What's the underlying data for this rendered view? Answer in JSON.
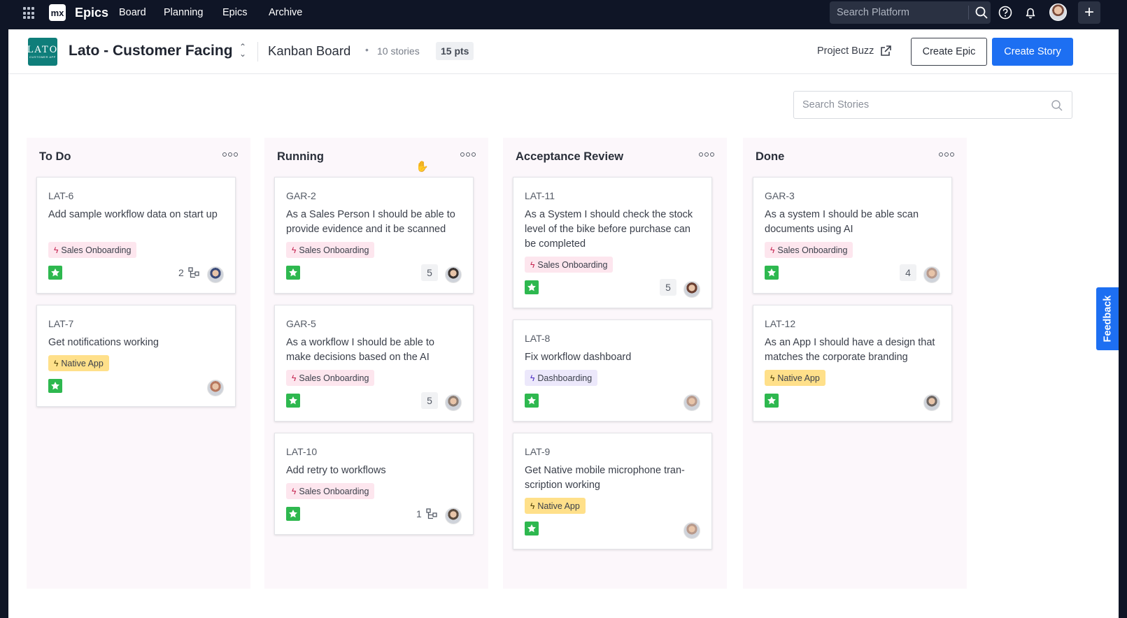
{
  "topnav": {
    "logo": "mx",
    "app_name": "Epics",
    "links": [
      "Board",
      "Planning",
      "Epics",
      "Archive"
    ],
    "search_placeholder": "Search Platform"
  },
  "header": {
    "logo_text": "LATO",
    "logo_subtext": "CUSTOMER APP",
    "project_title": "Lato - Customer Facing",
    "board_title": "Kanban Board",
    "dot": "•",
    "stories_count": "10 stories",
    "points": "15 pts",
    "project_buzz": "Project Buzz",
    "create_epic": "Create Epic",
    "create_story": "Create Story"
  },
  "search_stories_placeholder": "Search Stories",
  "feedback": "Feedback",
  "columns": [
    {
      "title": "To Do",
      "cards": [
        {
          "id": "LAT-6",
          "title": "Add sample workflow data on start up",
          "tag": "Sales Onboarding",
          "subtasks": "2",
          "avatar_color": "#3b4a78"
        },
        {
          "id": "LAT-7",
          "title": "Get notifications working",
          "tag": "Native App",
          "avatar_color": "#b7785f"
        }
      ]
    },
    {
      "title": "Running",
      "cards": [
        {
          "id": "GAR-2",
          "title": "As a Sales Person I should be able to provide evidence and it be scanned",
          "tag": "Sales Onboarding",
          "points": "5",
          "avatar_color": "#3a3330"
        },
        {
          "id": "GAR-5",
          "title": "As a workflow I should be able to make decisions based on the AI",
          "tag": "Sales Onboarding",
          "points": "5",
          "avatar_color": "#8c7c72"
        },
        {
          "id": "LAT-10",
          "title": "Add retry to workflows",
          "tag": "Sales Onboarding",
          "subtasks": "1",
          "avatar_color": "#5a4a3e"
        }
      ]
    },
    {
      "title": "Acceptance Review",
      "cards": [
        {
          "id": "LAT-11",
          "title": "As a System I should check the stock level of the bike before purchase can be completed",
          "tag": "Sales Onboarding",
          "points": "5",
          "avatar_color": "#6b4032"
        },
        {
          "id": "LAT-8",
          "title": "Fix workflow dashboard",
          "tag": "Dashboarding",
          "avatar_color": "#b89a8c"
        },
        {
          "id": "LAT-9",
          "title": "Get Native mobile microphone tran-scription working",
          "tag": "Native App",
          "avatar_color": "#b89a8c"
        }
      ]
    },
    {
      "title": "Done",
      "cards": [
        {
          "id": "GAR-3",
          "title": "As a system I should be able scan documents using AI",
          "tag": "Sales Onboarding",
          "points": "4",
          "avatar_color": "#b89a8c"
        },
        {
          "id": "LAT-12",
          "title": "As an App I should have a design that matches the corporate branding",
          "tag": "Native App",
          "avatar_color": "#6e6662"
        }
      ]
    }
  ]
}
